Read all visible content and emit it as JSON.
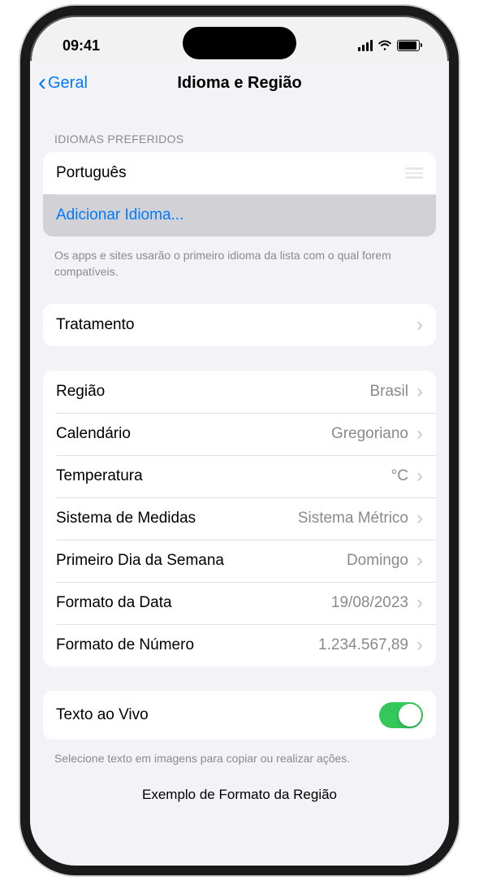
{
  "status": {
    "time": "09:41"
  },
  "nav": {
    "back_label": "Geral",
    "title": "Idioma e Região"
  },
  "languages": {
    "header": "IDIOMAS PREFERIDOS",
    "primary": "Português",
    "add_label": "Adicionar Idioma...",
    "footer": "Os apps e sites usarão o primeiro idioma da lista com o qual forem compatíveis."
  },
  "treatment": {
    "label": "Tratamento"
  },
  "region_settings": {
    "region": {
      "label": "Região",
      "value": "Brasil"
    },
    "calendar": {
      "label": "Calendário",
      "value": "Gregoriano"
    },
    "temperature": {
      "label": "Temperatura",
      "value": "°C"
    },
    "measurement": {
      "label": "Sistema de Medidas",
      "value": "Sistema Métrico"
    },
    "first_day": {
      "label": "Primeiro Dia da Semana",
      "value": "Domingo"
    },
    "date_format": {
      "label": "Formato da Data",
      "value": "19/08/2023"
    },
    "number_format": {
      "label": "Formato de Número",
      "value": "1.234.567,89"
    }
  },
  "live_text": {
    "label": "Texto ao Vivo",
    "enabled": true,
    "footer": "Selecione texto em imagens para copiar ou realizar ações."
  },
  "example": {
    "header": "Exemplo de Formato da Região"
  }
}
